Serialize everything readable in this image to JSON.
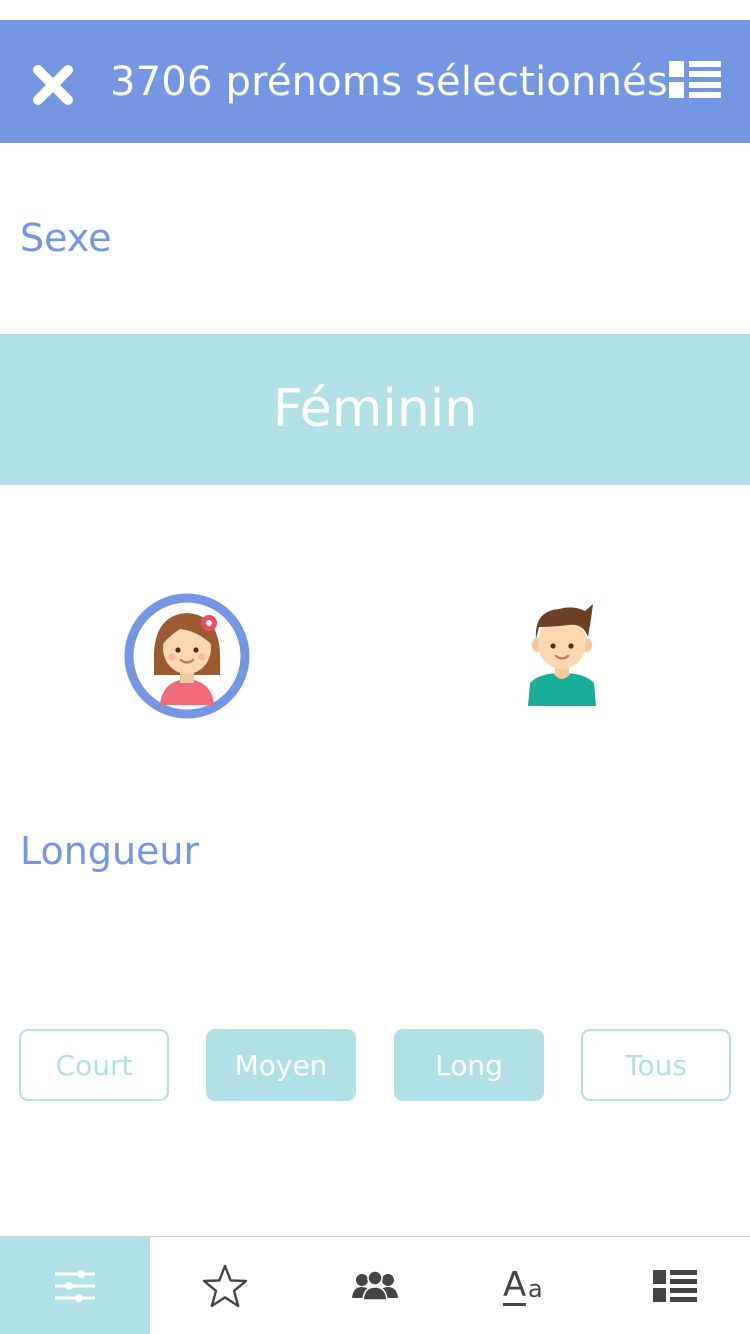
{
  "header": {
    "title": "3706 prénoms sélectionnés",
    "close_icon": "close-icon",
    "list_icon": "list-icon",
    "background": "#7496e3"
  },
  "sexe": {
    "label": "Sexe",
    "selected": "Féminin",
    "options": [
      {
        "name": "girl-avatar",
        "selected": true
      },
      {
        "name": "boy-avatar",
        "selected": false
      }
    ]
  },
  "longueur": {
    "label": "Longueur",
    "buttons": [
      {
        "label": "Court",
        "selected": false
      },
      {
        "label": "Moyen",
        "selected": true
      },
      {
        "label": "Long",
        "selected": true
      },
      {
        "label": "Tous",
        "selected": false
      }
    ]
  },
  "tabbar": {
    "tabs": [
      {
        "icon": "sliders-icon",
        "active": true
      },
      {
        "icon": "star-icon",
        "active": false
      },
      {
        "icon": "people-icon",
        "active": false
      },
      {
        "icon": "text-size-icon",
        "glyph_a": "A",
        "glyph_b": "a",
        "active": false
      },
      {
        "icon": "list-icon",
        "active": false
      }
    ]
  },
  "colors": {
    "accent": "#7496e3",
    "highlight": "#b1e0e5",
    "icon_dark": "#444444"
  }
}
